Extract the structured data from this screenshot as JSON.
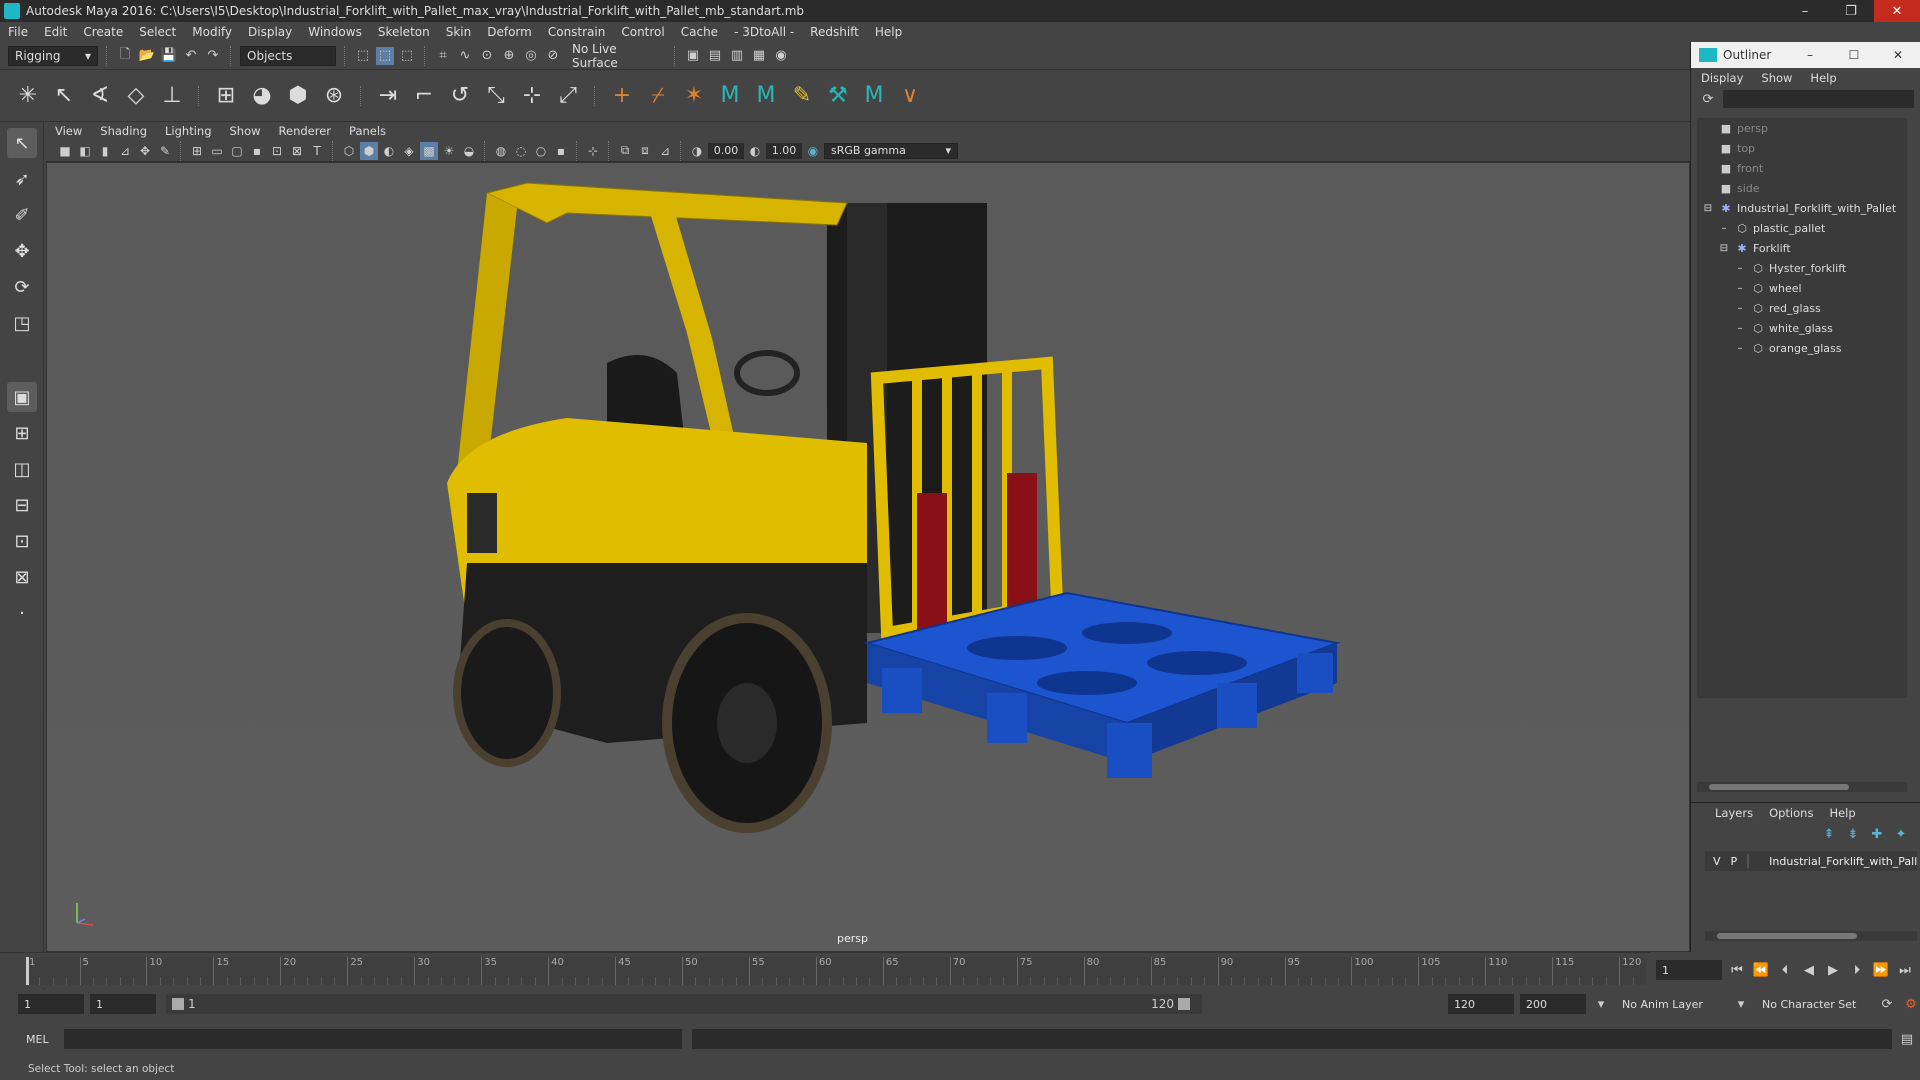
{
  "window": {
    "title": "Autodesk Maya 2016: C:\\Users\\I5\\Desktop\\Industrial_Forklift_with_Pallet_max_vray\\Industrial_Forklift_with_Pallet_mb_standart.mb",
    "minimize": "–",
    "maximize": "❐",
    "close": "✕"
  },
  "menubar": [
    "File",
    "Edit",
    "Create",
    "Select",
    "Modify",
    "Display",
    "Windows",
    "Skeleton",
    "Skin",
    "Deform",
    "Constrain",
    "Control",
    "Cache",
    "- 3DtoAll -",
    "Redshift",
    "Help"
  ],
  "statusline": {
    "mode": "Rigging",
    "selection_mode": "Objects",
    "live_surface": "No Live Surface"
  },
  "panel": {
    "menu": [
      "View",
      "Shading",
      "Lighting",
      "Show",
      "Renderer",
      "Panels"
    ],
    "exposure": "0.00",
    "gamma": "1.00",
    "color_space": "sRGB gamma",
    "camera": "persp"
  },
  "timeline": {
    "ticks": [
      "1",
      "5",
      "10",
      "15",
      "20",
      "25",
      "30",
      "35",
      "40",
      "45",
      "50",
      "55",
      "60",
      "65",
      "70",
      "75",
      "80",
      "85",
      "90",
      "95",
      "100",
      "105",
      "110",
      "115",
      "120"
    ],
    "current_frame": "1"
  },
  "range": {
    "start": "1",
    "inner_start": "1",
    "slider_start": "1",
    "slider_end": "120",
    "end": "120",
    "max_end": "200",
    "anim_layer": "No Anim Layer",
    "character_set": "No Character Set"
  },
  "cmdline": {
    "label": "MEL"
  },
  "helpline": {
    "text": "Select Tool: select an object"
  },
  "outliner": {
    "title": "Outliner",
    "menu": [
      "Display",
      "Show",
      "Help"
    ],
    "items": [
      {
        "label": "persp",
        "depth": 1,
        "dim": true,
        "icon": "camera-icon"
      },
      {
        "label": "top",
        "depth": 1,
        "dim": true,
        "icon": "camera-icon"
      },
      {
        "label": "front",
        "depth": 1,
        "dim": true,
        "icon": "camera-icon"
      },
      {
        "label": "side",
        "depth": 1,
        "dim": true,
        "icon": "camera-icon"
      },
      {
        "label": "Industrial_Forklift_with_Pallet",
        "depth": 1,
        "dim": false,
        "icon": "group-icon",
        "expander": "−"
      },
      {
        "label": "plastic_pallet",
        "depth": 2,
        "dim": false,
        "icon": "mesh-icon"
      },
      {
        "label": "Forklift",
        "depth": 2,
        "dim": false,
        "icon": "group-icon",
        "expander": "−"
      },
      {
        "label": "Hyster_forklift",
        "depth": 3,
        "dim": false,
        "icon": "mesh-icon"
      },
      {
        "label": "wheel",
        "depth": 3,
        "dim": false,
        "icon": "mesh-icon"
      },
      {
        "label": "red_glass",
        "depth": 3,
        "dim": false,
        "icon": "mesh-icon"
      },
      {
        "label": "white_glass",
        "depth": 3,
        "dim": false,
        "icon": "mesh-icon"
      },
      {
        "label": "orange_glass",
        "depth": 3,
        "dim": false,
        "icon": "mesh-icon"
      }
    ]
  },
  "layers": {
    "menu": [
      "Layers",
      "Options",
      "Help"
    ],
    "row": {
      "v": "V",
      "p": "P",
      "name": "Industrial_Forklift_with_Pallet",
      "color": "#a0102a"
    }
  },
  "colors": {
    "forklift_yellow": "#d6b400",
    "pallet_blue": "#1a4fc4",
    "fork_red": "#8a1018"
  }
}
